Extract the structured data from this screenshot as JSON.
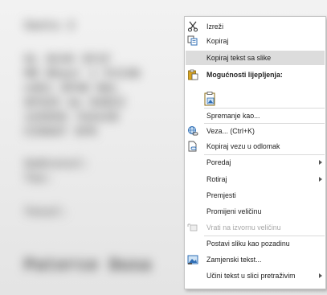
{
  "menu": {
    "cut": "Izreži",
    "copy": "Kopiraj",
    "copy_text_from_image": "Kopiraj tekst sa slike",
    "paste_options": "Mogućnosti lijepljenja:",
    "save_as": "Spremanje kao...",
    "link": "Veza... (Ctrl+K)",
    "copy_link": "Kopiraj vezu u odlomak",
    "arrange": "Poredaj",
    "rotate": "Rotiraj",
    "move": "Premjesti",
    "resize": "Promijeni veličinu",
    "restore_size": "Vrati na izvornu veličinu",
    "set_as_background": "Postavi sliku kao pozadinu",
    "alt_text": "Zamjenski tekst...",
    "make_searchable": "Učini tekst u slici pretraživim"
  },
  "highlighted_item": "copy_text_from_image",
  "colors": {
    "highlight": "#dcdcdc",
    "menu_bg": "#ffffff",
    "icon_blue": "#2e6db4",
    "icon_gold": "#d9a520"
  }
}
